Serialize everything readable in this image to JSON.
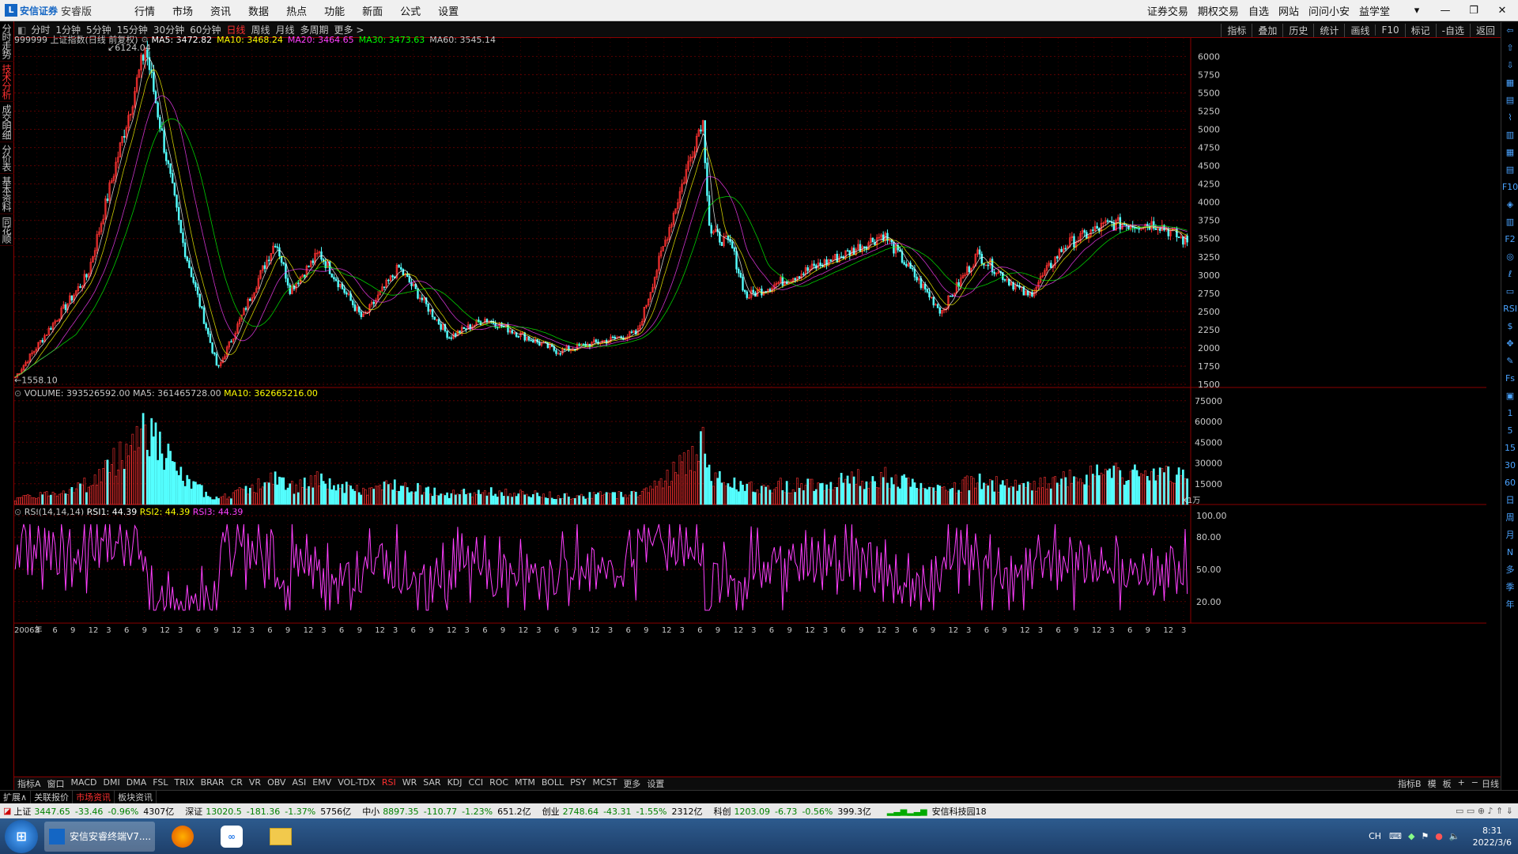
{
  "app": {
    "logo_mark": "L",
    "logo_text": "安信证券",
    "edition": "安睿版"
  },
  "menu": {
    "left": [
      "行情",
      "市场",
      "资讯",
      "数据",
      "热点",
      "功能",
      "新面",
      "公式",
      "设置"
    ],
    "right": [
      "证券交易",
      "期权交易",
      "自选",
      "网站",
      "问问小安",
      "益学堂"
    ],
    "window_controls": [
      "▾",
      "—",
      "❐",
      "✕"
    ]
  },
  "left_tabs": [
    {
      "label": "分时走势",
      "active": false
    },
    {
      "label": "技术分析",
      "active": true
    },
    {
      "label": "成交明细",
      "active": false
    },
    {
      "label": "分价表",
      "active": false
    },
    {
      "label": "基本资料",
      "active": false
    },
    {
      "label": "同花顺",
      "active": false
    }
  ],
  "period_buttons": [
    {
      "label": "分时",
      "active": false
    },
    {
      "label": "1分钟",
      "active": false
    },
    {
      "label": "5分钟",
      "active": false
    },
    {
      "label": "15分钟",
      "active": false
    },
    {
      "label": "30分钟",
      "active": false
    },
    {
      "label": "60分钟",
      "active": false
    },
    {
      "label": "日线",
      "active": true
    },
    {
      "label": "周线",
      "active": false
    },
    {
      "label": "月线",
      "active": false
    },
    {
      "label": "多周期",
      "active": false
    },
    {
      "label": "更多 >",
      "active": false
    }
  ],
  "toolbar_right": [
    "指标",
    "叠加",
    "历史",
    "统计",
    "画线",
    "F10",
    "标记",
    "-自选",
    "返回"
  ],
  "price_panel": {
    "symbol": "999999 上证指数(日线 前复权)",
    "ma": [
      {
        "label": "MA5: 3472.82",
        "color": "#ffffff"
      },
      {
        "label": "MA10: 3468.24",
        "color": "#ffff00"
      },
      {
        "label": "MA20: 3464.65",
        "color": "#ff40ff"
      },
      {
        "label": "MA30: 3473.63",
        "color": "#00ff00"
      },
      {
        "label": "MA60: 3545.14",
        "color": "#c8c8c8"
      }
    ],
    "high_label": "6124.04",
    "low_label": "1558.10",
    "y_ticks": [
      "6000",
      "5750",
      "5500",
      "5250",
      "5000",
      "4750",
      "4500",
      "4250",
      "4000",
      "3750",
      "3500",
      "3250",
      "3000",
      "2750",
      "2500",
      "2250",
      "2000",
      "1750",
      "1500"
    ]
  },
  "volume_panel": {
    "label": "VOLUME: 393526592.00",
    "ma5": "MA5: 361465728.00",
    "ma10": "MA10: 362665216.00",
    "y_ticks": [
      "75000",
      "60000",
      "45000",
      "30000",
      "15000"
    ],
    "unit": "X1万"
  },
  "rsi_panel": {
    "label": "RSI(14,14,14)",
    "rsi1": "RSI1: 44.39",
    "rsi2": "RSI2: 44.39",
    "rsi3": "RSI3: 44.39",
    "y_ticks": [
      "100.00",
      "80.00",
      "50.00",
      "20.00"
    ]
  },
  "chart_data": {
    "type": "candlestick",
    "price_range": [
      1500,
      6124.04
    ],
    "price_path_index": [
      [
        2006.0,
        1600
      ],
      [
        2007.0,
        3000
      ],
      [
        2007.8,
        6124
      ],
      [
        2008.3,
        3500
      ],
      [
        2008.8,
        1700
      ],
      [
        2009.6,
        3478
      ],
      [
        2009.8,
        2800
      ],
      [
        2010.2,
        3300
      ],
      [
        2010.8,
        2400
      ],
      [
        2011.3,
        3100
      ],
      [
        2012.0,
        2150
      ],
      [
        2012.5,
        2400
      ],
      [
        2013.5,
        1950
      ],
      [
        2014.6,
        2200
      ],
      [
        2015.5,
        5178
      ],
      [
        2015.6,
        3600
      ],
      [
        2015.9,
        3400
      ],
      [
        2016.1,
        2700
      ],
      [
        2017.5,
        3300
      ],
      [
        2018.0,
        3559
      ],
      [
        2018.8,
        2500
      ],
      [
        2019.3,
        3288
      ],
      [
        2020.0,
        2700
      ],
      [
        2020.5,
        3400
      ],
      [
        2021.1,
        3700
      ],
      [
        2021.8,
        3700
      ],
      [
        2022.2,
        3447
      ]
    ],
    "volume_range": [
      0,
      75000
    ],
    "volume_unit": "万",
    "rsi_range": [
      0,
      100
    ],
    "x_tick_labels": [
      "2006年",
      "3",
      "6",
      "9",
      "12",
      "3",
      "6",
      "9",
      "12",
      "3",
      "6",
      "9",
      "12",
      "3",
      "6",
      "9",
      "12",
      "3",
      "6",
      "9",
      "12",
      "3",
      "6",
      "9",
      "12",
      "3",
      "6",
      "9",
      "12",
      "3",
      "6",
      "9",
      "12",
      "3",
      "6",
      "9",
      "12",
      "3",
      "6",
      "9",
      "12",
      "3",
      "6",
      "9",
      "12",
      "3",
      "6",
      "9",
      "12",
      "3",
      "6",
      "9",
      "12",
      "3",
      "6",
      "9",
      "12",
      "3",
      "6",
      "9",
      "12",
      "3",
      "6",
      "9",
      "12",
      "3"
    ]
  },
  "right_icons": [
    "⇦",
    "⇧",
    "⇩",
    "▦",
    "▤",
    "⌇",
    "▥",
    "▦",
    "▤",
    "F10",
    "◈",
    "▥",
    "F2",
    "◎",
    "ℓ",
    "▭",
    "RSI",
    "$",
    "✥",
    "✎",
    "Fs",
    "▣",
    "1",
    "5",
    "15",
    "30",
    "60",
    "日",
    "周",
    "月",
    "N",
    "多",
    "季",
    "年"
  ],
  "indicator_tabs": [
    {
      "label": "指标A",
      "active": false
    },
    {
      "label": "窗口",
      "active": false
    },
    {
      "label": "MACD",
      "active": false
    },
    {
      "label": "DMI",
      "active": false
    },
    {
      "label": "DMA",
      "active": false
    },
    {
      "label": "FSL",
      "active": false
    },
    {
      "label": "TRIX",
      "active": false
    },
    {
      "label": "BRAR",
      "active": false
    },
    {
      "label": "CR",
      "active": false
    },
    {
      "label": "VR",
      "active": false
    },
    {
      "label": "OBV",
      "active": false
    },
    {
      "label": "ASI",
      "active": false
    },
    {
      "label": "EMV",
      "active": false
    },
    {
      "label": "VOL-TDX",
      "active": false
    },
    {
      "label": "RSI",
      "active": true
    },
    {
      "label": "WR",
      "active": false
    },
    {
      "label": "SAR",
      "active": false
    },
    {
      "label": "KDJ",
      "active": false
    },
    {
      "label": "CCI",
      "active": false
    },
    {
      "label": "ROC",
      "active": false
    },
    {
      "label": "MTM",
      "active": false
    },
    {
      "label": "BOLL",
      "active": false
    },
    {
      "label": "PSY",
      "active": false
    },
    {
      "label": "MCST",
      "active": false
    },
    {
      "label": "更多",
      "active": false
    },
    {
      "label": "设置",
      "active": false
    }
  ],
  "indicator_tabs_right": [
    "指标B",
    "模",
    "板",
    "+",
    "−"
  ],
  "bottom_period": "日线",
  "sub_tabs": [
    {
      "label": "扩展∧",
      "active": false
    },
    {
      "label": "关联报价",
      "active": false
    },
    {
      "label": "市场资讯",
      "active": true
    },
    {
      "label": "板块资讯",
      "active": false
    }
  ],
  "status": [
    {
      "name": "上证",
      "value": "3447.65",
      "chg": "-33.46",
      "pct": "-0.96%",
      "amt": "4307亿"
    },
    {
      "name": "深证",
      "value": "13020.5",
      "chg": "-181.36",
      "pct": "-1.37%",
      "amt": "5756亿"
    },
    {
      "name": "中小",
      "value": "8897.35",
      "chg": "-110.77",
      "pct": "-1.23%",
      "amt": "651.2亿"
    },
    {
      "name": "创业",
      "value": "2748.64",
      "chg": "-43.31",
      "pct": "-1.55%",
      "amt": "2312亿"
    },
    {
      "name": "科创",
      "value": "1203.09",
      "chg": "-6.73",
      "pct": "-0.56%",
      "amt": "399.3亿"
    }
  ],
  "status_news": "安信科技园18",
  "taskbar": {
    "active_app": "安信安睿终端V7....",
    "ime": "CH",
    "time": "8:31",
    "date": "2022/3/6"
  }
}
